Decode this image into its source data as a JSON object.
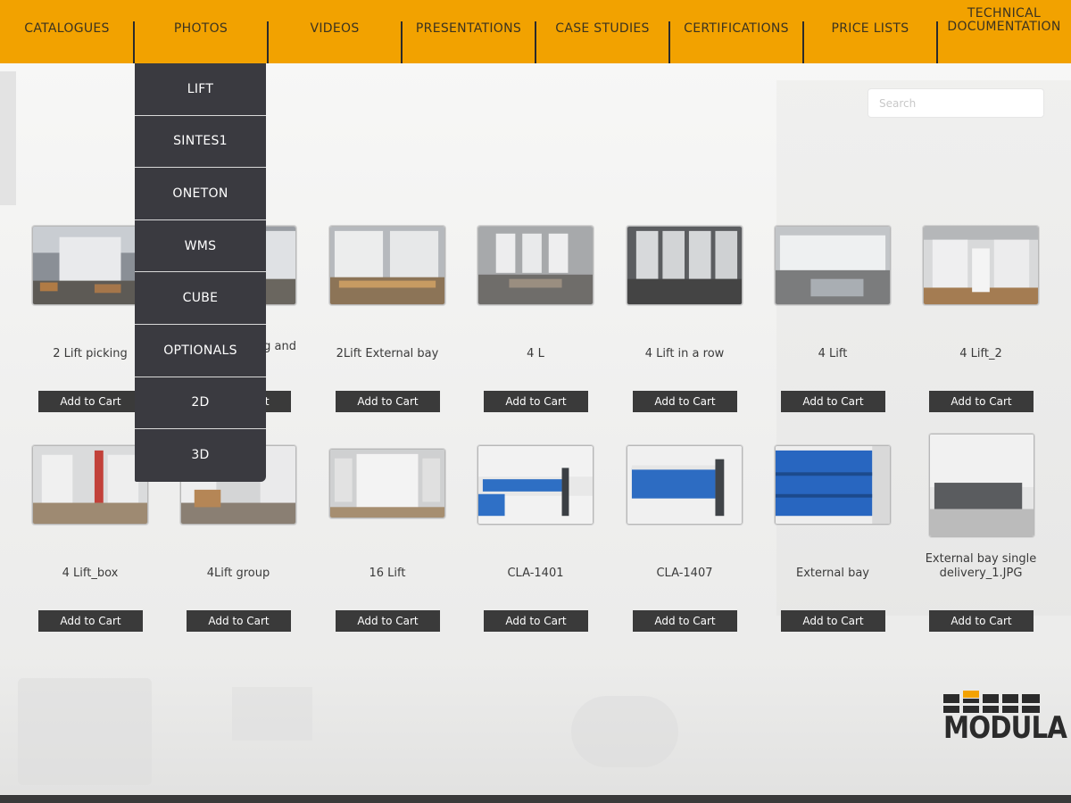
{
  "nav": {
    "items": [
      {
        "label": "CATALOGUES"
      },
      {
        "label": "PHOTOS"
      },
      {
        "label": "VIDEOS"
      },
      {
        "label": "PRESENTATIONS"
      },
      {
        "label": "CASE STUDIES"
      },
      {
        "label": "CERTIFICATIONS"
      },
      {
        "label": "PRICE LISTS"
      },
      {
        "label": "TECHNICAL DOCUMENTATION"
      }
    ]
  },
  "photos_menu": {
    "items": [
      "LIFT",
      "SINTES1",
      "ONETON",
      "WMS",
      "CUBE",
      "OPTIONALS",
      "2D",
      "3D"
    ]
  },
  "search": {
    "placeholder": "Search",
    "value": ""
  },
  "products": [
    {
      "caption": "2 Lift picking",
      "button": "Add to Cart"
    },
    {
      "caption": "2Lift picking and",
      "button": "Add to Cart"
    },
    {
      "caption": "2Lift External bay",
      "button": "Add to Cart"
    },
    {
      "caption": "4 L",
      "button": "Add to Cart"
    },
    {
      "caption": "4 Lift in a row",
      "button": "Add to Cart"
    },
    {
      "caption": "4 Lift",
      "button": "Add to Cart"
    },
    {
      "caption": "4 Lift_2",
      "button": "Add to Cart"
    },
    {
      "caption": "4 Lift_box",
      "button": "Add to Cart"
    },
    {
      "caption": "4Lift group",
      "button": "Add to Cart"
    },
    {
      "caption": "16 Lift",
      "button": "Add to Cart"
    },
    {
      "caption": "CLA-1401",
      "button": "Add to Cart"
    },
    {
      "caption": "CLA-1407",
      "button": "Add to Cart"
    },
    {
      "caption": "External bay",
      "button": "Add to Cart"
    },
    {
      "caption": "External bay single delivery_1.JPG",
      "button": "Add to Cart"
    }
  ],
  "brand": {
    "logo_text": "MODULA",
    "accent": "#f2a200",
    "dark": "#3a3a40"
  }
}
